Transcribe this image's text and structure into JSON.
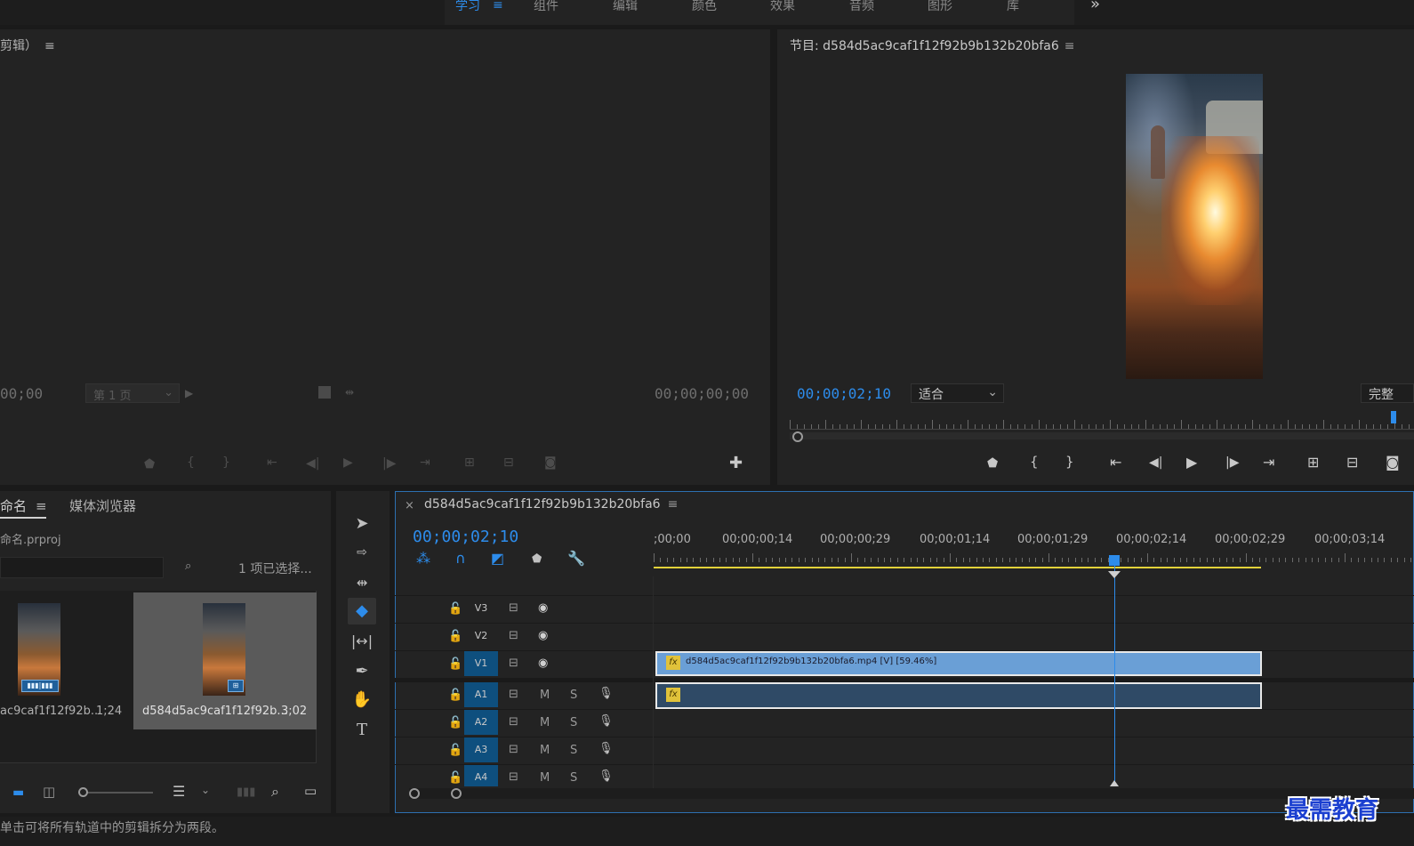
{
  "top_menu": {
    "items": [
      "学习",
      "组件",
      "编辑",
      "颜色",
      "效果",
      "音频",
      "图形",
      "库"
    ],
    "more_label": "»"
  },
  "source_monitor": {
    "title": "剪辑）",
    "timecode_left": "00;00",
    "page_select": "第 1 页",
    "timecode_right": "00;00;00;00"
  },
  "program_monitor": {
    "title": "节目: d584d5ac9caf1f12f92b9b132b20bfa6",
    "timecode": "00;00;02;10",
    "fit_select": "适合",
    "quality_select": "完整"
  },
  "project_panel": {
    "tab_project": "命名",
    "tab_media_browser": "媒体浏览器",
    "project_file": "命名.prproj",
    "selection_status": "1 项已选择...",
    "items": [
      {
        "name": "ac9caf1f12f92b...",
        "duration": "1;24"
      },
      {
        "name": "d584d5ac9caf1f12f92b...",
        "duration": "3;02"
      }
    ]
  },
  "timeline": {
    "sequence_name": "d584d5ac9caf1f12f92b9b132b20bfa6",
    "timecode": "00;00;02;10",
    "ruler_labels": [
      ";00;00",
      "00;00;00;14",
      "00;00;00;29",
      "00;00;01;14",
      "00;00;01;29",
      "00;00;02;14",
      "00;00;02;29",
      "00;00;03;14"
    ],
    "video_tracks": [
      "V3",
      "V2",
      "V1"
    ],
    "audio_tracks": [
      "A1",
      "A2",
      "A3",
      "A4"
    ],
    "audio_buttons": {
      "mute": "M",
      "solo": "S"
    },
    "video_clip_label": "d584d5ac9caf1f12f92b9b132b20bfa6.mp4 [V] [59.46%]",
    "fx_badge": "fx"
  },
  "status_bar": {
    "text": "单击可将所有轨道中的剪辑拆分为两段。"
  },
  "watermark": "最需教育",
  "colors": {
    "accent": "#2d8ceb",
    "clip_video": "#6a9fd6",
    "clip_audio": "#2f4a66",
    "track_active": "#0e4f7e"
  }
}
